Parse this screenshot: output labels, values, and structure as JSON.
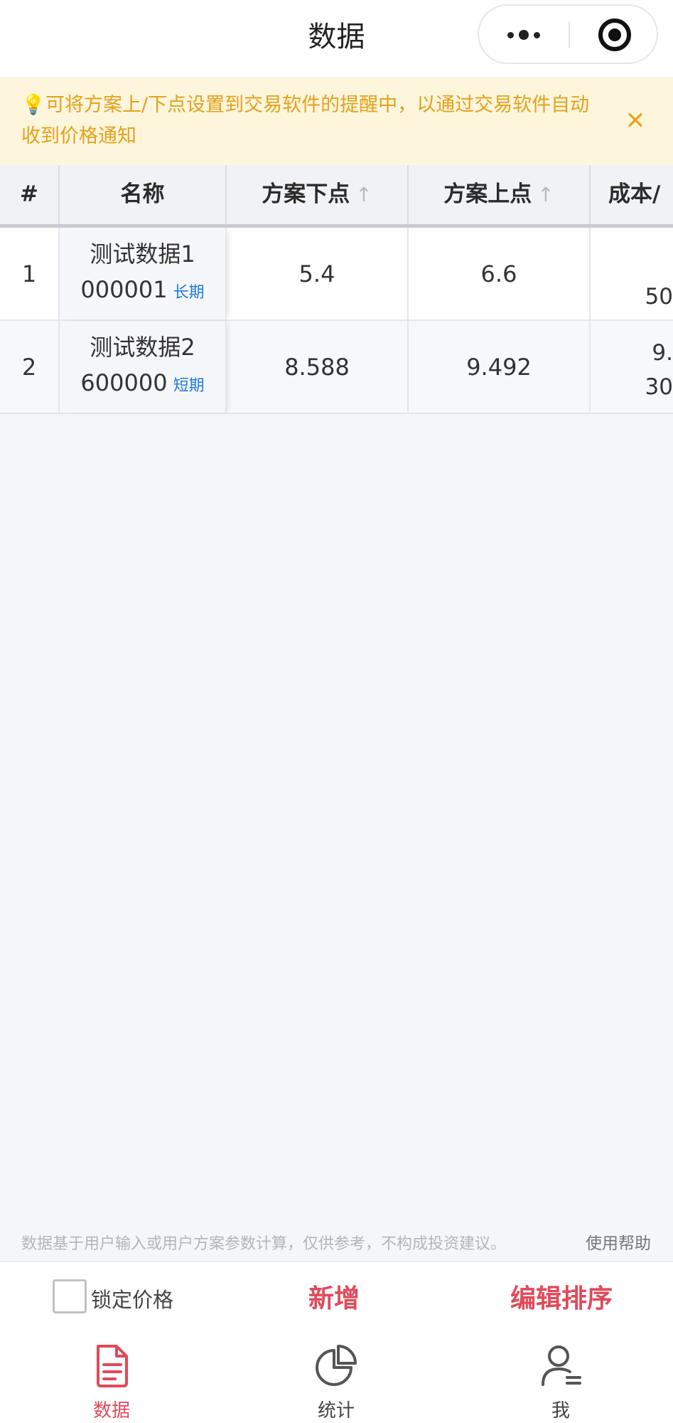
{
  "header": {
    "title": "数据"
  },
  "notice": {
    "text": "可将方案上/下点设置到交易软件的提醒中，以通过交易软件自动收到价格通知"
  },
  "table": {
    "columns": [
      "#",
      "名称",
      "方案下点",
      "方案上点",
      "成本/"
    ],
    "rows": [
      {
        "index": "1",
        "name": "测试数据1",
        "code": "000001",
        "tag": "长期",
        "lower": "5.4",
        "upper": "6.6",
        "cost_line2": "50"
      },
      {
        "index": "2",
        "name": "测试数据2",
        "code": "600000",
        "tag": "短期",
        "lower": "8.588",
        "upper": "9.492",
        "cost_line1": "9.",
        "cost_line2": "30"
      }
    ]
  },
  "footer": {
    "disclaimer": "数据基于用户输入或用户方案参数计算，仅供参考，不构成投资建议。",
    "help": "使用帮助"
  },
  "actions": {
    "lock_label": "锁定价格",
    "lock_checked": false,
    "add_label": "新增",
    "sort_label": "编辑排序"
  },
  "tabbar": {
    "items": [
      {
        "label": "数据",
        "icon": "document-icon",
        "active": true
      },
      {
        "label": "统计",
        "icon": "pie-chart-icon",
        "active": false
      },
      {
        "label": "我",
        "icon": "user-icon",
        "active": false
      }
    ]
  },
  "colors": {
    "accent": "#e04a5a",
    "notice_bg": "#fdf5dc",
    "notice_text": "#e3a21b",
    "tag_blue": "#1e7ad6"
  }
}
